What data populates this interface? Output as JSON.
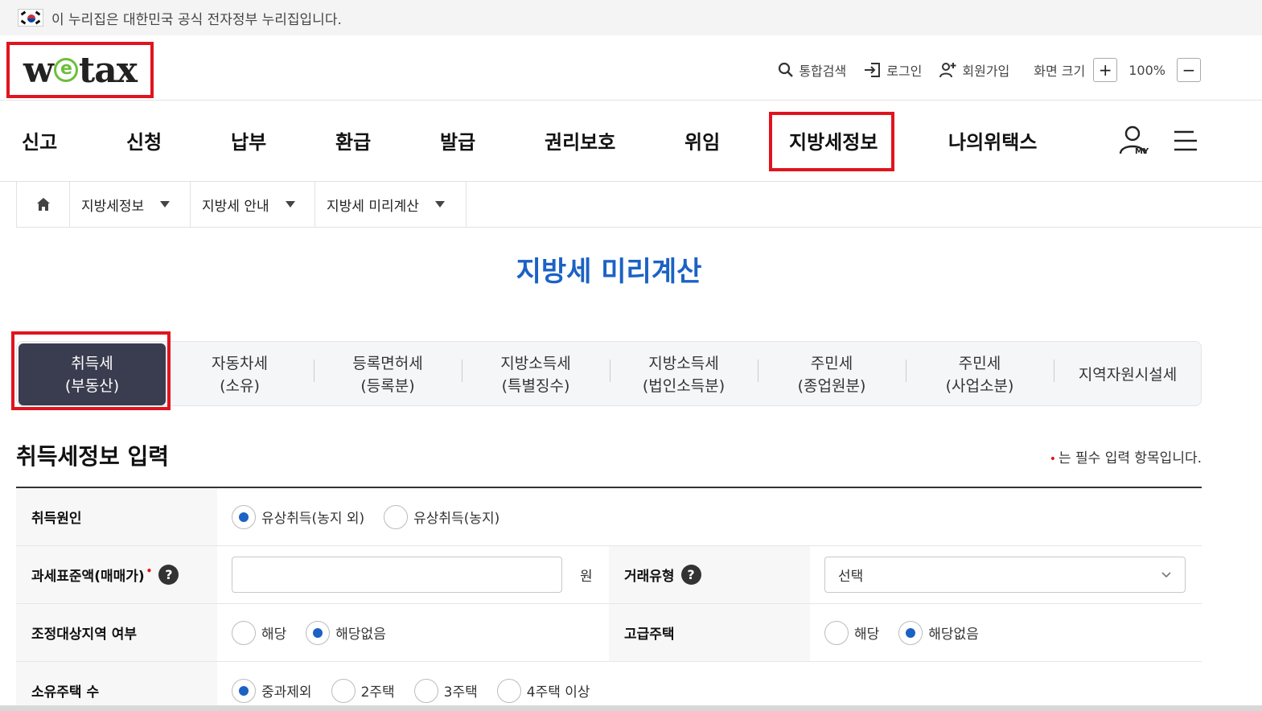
{
  "gov_banner": {
    "text": "이 누리집은 대한민국 공식 전자정부 누리집입니다."
  },
  "header": {
    "logo": "wetax",
    "utils": {
      "search": "통합검색",
      "login": "로그인",
      "signup": "회원가입",
      "zoom_label": "화면 크기",
      "zoom_plus": "+",
      "zoom_value": "100%",
      "zoom_minus": "−"
    }
  },
  "nav": {
    "items": [
      "신고",
      "신청",
      "납부",
      "환급",
      "발급",
      "권리보호",
      "위임",
      "지방세정보",
      "나의위택스"
    ],
    "highlighted": "지방세정보"
  },
  "breadcrumb": {
    "items": [
      "지방세정보",
      "지방세 안내",
      "지방세 미리계산"
    ]
  },
  "page": {
    "title": "지방세 미리계산"
  },
  "tabs": [
    {
      "line1": "취득세",
      "line2": "(부동산)",
      "active": true
    },
    {
      "line1": "자동차세",
      "line2": "(소유)"
    },
    {
      "line1": "등록면허세",
      "line2": "(등록분)"
    },
    {
      "line1": "지방소득세",
      "line2": "(특별징수)"
    },
    {
      "line1": "지방소득세",
      "line2": "(법인소득분)"
    },
    {
      "line1": "주민세",
      "line2": "(종업원분)"
    },
    {
      "line1": "주민세",
      "line2": "(사업소분)"
    },
    {
      "line1": "지역자원시설세",
      "line2": ""
    }
  ],
  "section": {
    "title": "취득세정보 입력",
    "required_note": "는 필수 입력 항목입니다.",
    "required_mark": "•"
  },
  "form": {
    "acquisition_cause": {
      "label": "취득원인",
      "options": [
        "유상취득(농지 외)",
        "유상취득(농지)"
      ],
      "selected": "유상취득(농지 외)"
    },
    "tax_base": {
      "label": "과세표준액(매매가)",
      "value": "",
      "unit": "원",
      "help": "?"
    },
    "deal_type": {
      "label": "거래유형",
      "help": "?",
      "selected": "선택"
    },
    "adjust_area": {
      "label": "조정대상지역 여부",
      "options": [
        "해당",
        "해당없음"
      ],
      "selected": "해당없음"
    },
    "luxury_house": {
      "label": "고급주택",
      "options": [
        "해당",
        "해당없음"
      ],
      "selected": "해당없음"
    },
    "houses_owned": {
      "label": "소유주택 수",
      "options": [
        "중과제외",
        "2주택",
        "3주택",
        "4주택 이상"
      ],
      "selected": "중과제외"
    }
  },
  "colors": {
    "accent_blue": "#1b62c4",
    "highlight_red": "#e0141e",
    "active_tab": "#3a3d4f"
  }
}
